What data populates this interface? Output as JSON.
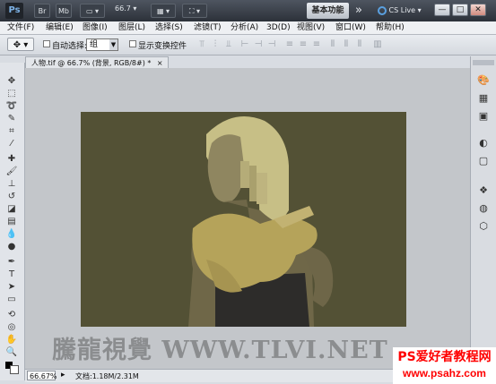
{
  "titlebar": {
    "app_logo": "Ps",
    "mb_label": "Mb",
    "zoom_value": "66.7",
    "workspace_button": "基本功能",
    "more": "»",
    "cslive": "CS Live",
    "minimize": "—",
    "restore": "□",
    "close": "✕"
  },
  "menu": [
    "文件(F)",
    "编辑(E)",
    "图像(I)",
    "图层(L)",
    "选择(S)",
    "滤镜(T)",
    "分析(A)",
    "3D(D)",
    "视图(V)",
    "窗口(W)",
    "帮助(H)"
  ],
  "options": {
    "auto_select_label": "自动选择:",
    "auto_select_value": "组",
    "show_transform_label": "显示变换控件"
  },
  "document": {
    "tab_title": "人物.tif @ 66.7% (背景, RGB/8#) *",
    "close": "×"
  },
  "status": {
    "zoom": "66.67%",
    "doc_info": "文档:1.18M/2.31M"
  },
  "watermark": "騰龍視覺 WWW.TLVI.NET",
  "footer": {
    "line1": "PS爱好者教程网",
    "line2": "www.psahz.com"
  },
  "colors": {
    "canvas_bg": "#535135",
    "workspace_bg": "#c3c6ca",
    "footer_text": "#ff0000"
  }
}
